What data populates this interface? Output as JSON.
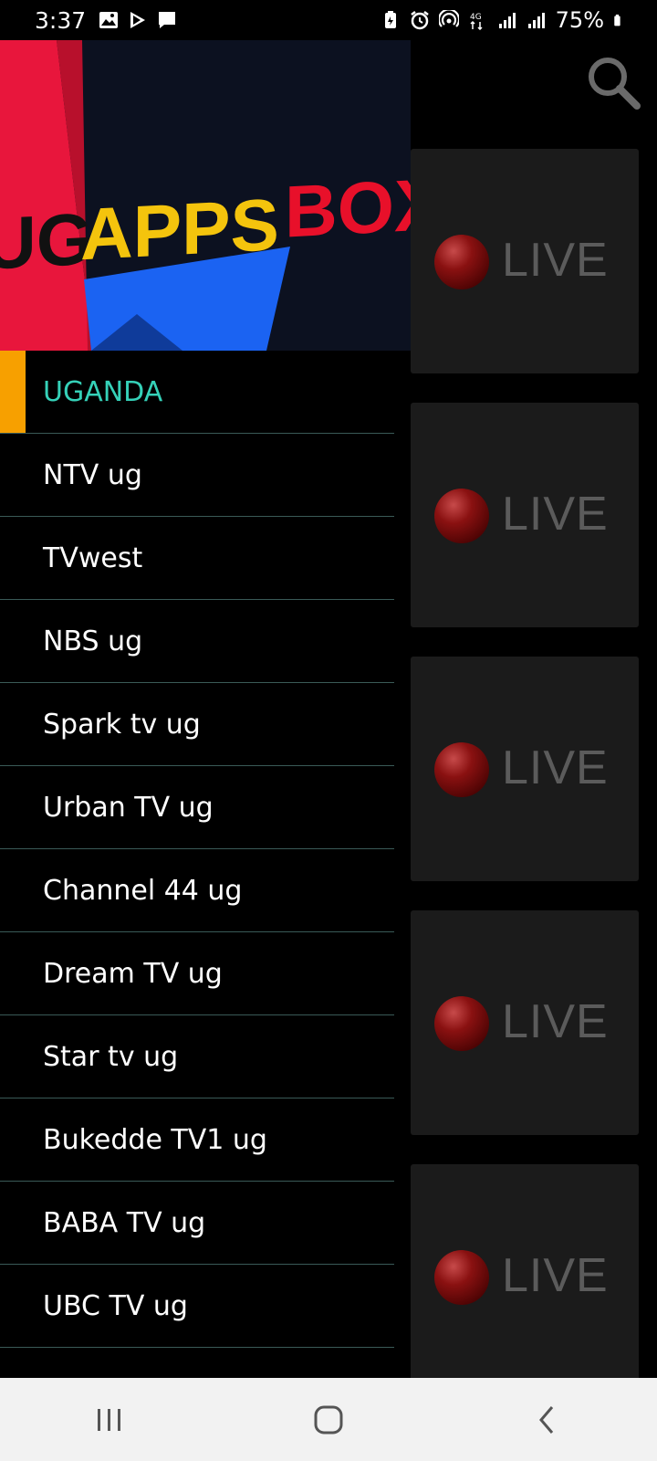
{
  "status_bar": {
    "time": "3:37",
    "battery_percent": "75%",
    "icons_left": [
      "gallery-icon",
      "play-store-icon",
      "message-icon"
    ],
    "icons_right": [
      "battery-saver-icon",
      "alarm-icon",
      "hotspot-icon",
      "4g-data-icon",
      "signal-icon",
      "signal-icon",
      "battery-icon"
    ]
  },
  "drawer": {
    "header_logo": {
      "part1": "UG",
      "part2": "APPS",
      "part3": "BOX"
    },
    "items": [
      {
        "label": "UGANDA",
        "selected": true
      },
      {
        "label": "NTV ug"
      },
      {
        "label": "TVwest"
      },
      {
        "label": "NBS ug"
      },
      {
        "label": "Spark tv ug"
      },
      {
        "label": "Urban TV ug"
      },
      {
        "label": "Channel 44 ug"
      },
      {
        "label": "Dream TV ug"
      },
      {
        "label": "Star tv ug"
      },
      {
        "label": "Bukedde TV1 ug"
      },
      {
        "label": "BABA TV ug"
      },
      {
        "label": "UBC TV ug"
      }
    ],
    "accent_color": "#f7a000",
    "selected_text_color": "#35d1b8"
  },
  "channel_grid": {
    "cards": [
      {
        "label": "LIVE"
      },
      {
        "label": "LIVE"
      },
      {
        "label": "LIVE"
      },
      {
        "label": "LIVE"
      },
      {
        "label": "LIVE"
      }
    ]
  },
  "nav_bar": {
    "buttons": [
      "recents-icon",
      "home-icon",
      "back-icon"
    ]
  }
}
